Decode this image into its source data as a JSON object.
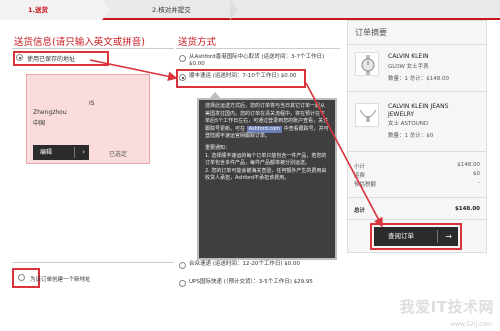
{
  "steps": [
    {
      "label": "1.送货"
    },
    {
      "label": "2.核对并提交"
    }
  ],
  "shipping_info": {
    "title": "送货信息(请只输入英文或拼音)",
    "use_saved_label": "使用已保存的地址",
    "address_lines": [
      "IS",
      "Zhengzhou",
      "中国"
    ],
    "edit_label": "编辑",
    "selected_label": "已选定",
    "new_address_label": "为该订单创建一个新地址"
  },
  "shipping_method": {
    "title": "送货方式",
    "options": [
      {
        "label": "从Ashford香港国际中心取货 (运送时间：3-7个工作日) $0.00"
      },
      {
        "label": "顺丰速运 (运送时间：7-10个工作日) $0.00"
      },
      {
        "label": "合众速递 (运送时间：12-20个工作日) $0.00"
      },
      {
        "label": "UPS国际快递 (（预计交货）：3-5个工作日) $29.95"
      }
    ]
  },
  "tooltip": {
    "para1_a": "选择此运送方式后，您的订单将与当日其它订单一起从美国发往国内，您的订单在清关流程中，将在预计在下单后5个工作日左右，可通过登录到您的账户查看，关注跟踪号更新。可在",
    "link": "Ashford.com",
    "para1_b": "中查看跟踪号，并可登陆顺丰速运官网跟踪订单。",
    "note_title": "重要通知：",
    "note1": "1. 选择顺丰速运的每个订单只能包含一件产品，若您的订单包含多件产品，每件产品都将被分别运送。",
    "note2": "2. 您的订单可能会被海关查验，任何额外产生的费用由收货人承担，Ashford不承担该费用。"
  },
  "summary": {
    "title": "订单摘要",
    "products": [
      {
        "brand": "CALVIN KLEIN",
        "desc": "GLOW 女士手表",
        "qty_label": "数量：",
        "qty": "1",
        "total_label": "总计：",
        "total": "$148.00"
      },
      {
        "brand": "CALVIN KLEIN JEANS",
        "brand2": "JEWELRY",
        "desc": "女士 ASTOUND",
        "qty_label": "数量：",
        "qty": "1",
        "total_label": "总计：",
        "total": "$0"
      }
    ],
    "totals": [
      {
        "label": "小计",
        "value": "$148.00"
      },
      {
        "label": "运费",
        "value": "$0"
      },
      {
        "label": "预估税额",
        "value": "-"
      }
    ],
    "grand_label": "总计",
    "grand_value": "$148.00",
    "checkout_label": "查阅订单"
  },
  "watermark": {
    "text": "我爱IT技术网",
    "url": "www.52ij.com"
  },
  "colors": {
    "accent": "#c8161d",
    "highlight": "#d9343b",
    "card": "#fbdcdc"
  }
}
